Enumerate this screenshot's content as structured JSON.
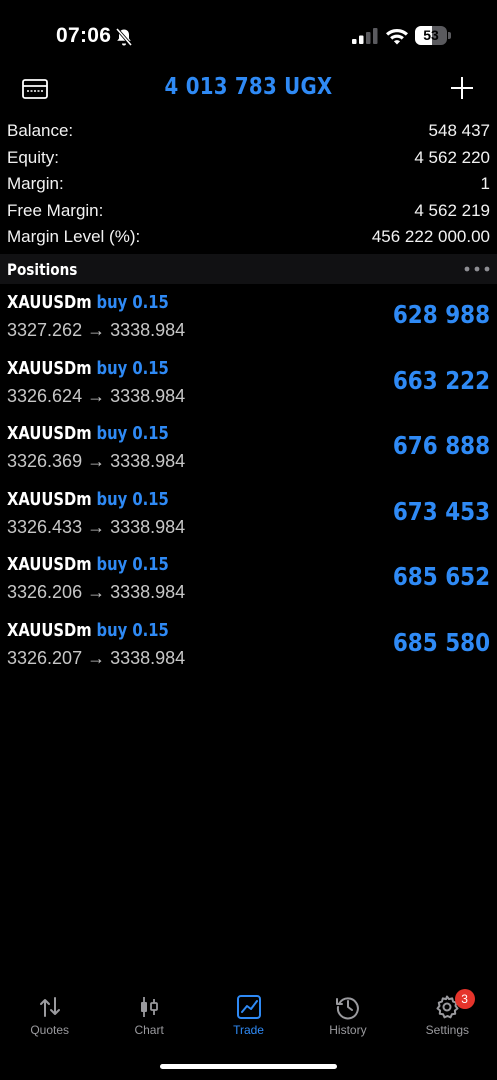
{
  "status": {
    "time": "07:06",
    "battery": "53",
    "battery_level": 0.53
  },
  "header": {
    "title": "4 013 783 UGX"
  },
  "summary": [
    {
      "label": "Balance:",
      "value": "548 437"
    },
    {
      "label": "Equity:",
      "value": "4 562 220"
    },
    {
      "label": "Margin:",
      "value": "1"
    },
    {
      "label": "Free Margin:",
      "value": "4 562 219"
    },
    {
      "label": "Margin Level (%):",
      "value": "456 222 000.00"
    }
  ],
  "positions_section": {
    "title": "Positions"
  },
  "positions": [
    {
      "symbol": "XAUUSDm",
      "side": "buy 0.15",
      "prices": "3327.262 → 3338.984",
      "profit": "628 988"
    },
    {
      "symbol": "XAUUSDm",
      "side": "buy 0.15",
      "prices": "3326.624 → 3338.984",
      "profit": "663 222"
    },
    {
      "symbol": "XAUUSDm",
      "side": "buy 0.15",
      "prices": "3326.369 → 3338.984",
      "profit": "676 888"
    },
    {
      "symbol": "XAUUSDm",
      "side": "buy 0.15",
      "prices": "3326.433 → 3338.984",
      "profit": "673 453"
    },
    {
      "symbol": "XAUUSDm",
      "side": "buy 0.15",
      "prices": "3326.206 → 3338.984",
      "profit": "685 652"
    },
    {
      "symbol": "XAUUSDm",
      "side": "buy 0.15",
      "prices": "3326.207 → 3338.984",
      "profit": "685 580"
    }
  ],
  "tabs": [
    {
      "label": "Quotes",
      "icon": "quotes-arrows-icon"
    },
    {
      "label": "Chart",
      "icon": "candlestick-chart-icon"
    },
    {
      "label": "Trade",
      "icon": "trade-chart-icon",
      "active": true
    },
    {
      "label": "History",
      "icon": "history-clock-icon"
    },
    {
      "label": "Settings",
      "icon": "gear-icon",
      "badge": "3"
    }
  ],
  "colors": {
    "accent": "#2f8af5",
    "background": "#000000",
    "badge": "#e5342b",
    "muted": "#9a9a9e"
  }
}
